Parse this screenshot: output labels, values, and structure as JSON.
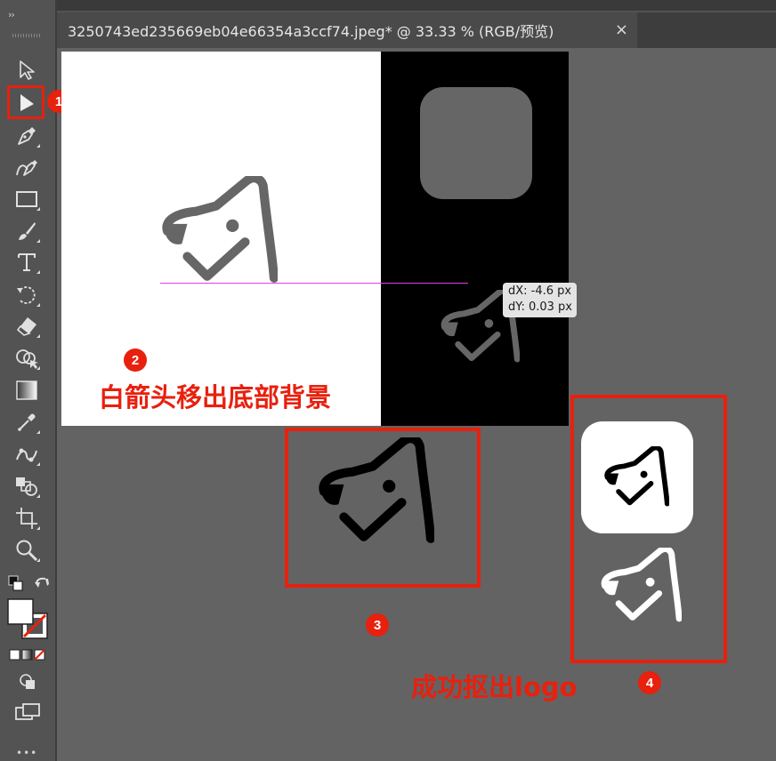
{
  "toolbar": {
    "collapse_glyph": "››",
    "tools": [
      {
        "name": "selection-tool",
        "icon": "arrow-outline-icon"
      },
      {
        "name": "direct-selection-tool",
        "icon": "arrow-filled-icon"
      },
      {
        "name": "pen-tool",
        "icon": "pen-icon"
      },
      {
        "name": "curvature-tool",
        "icon": "curvature-pen-icon"
      },
      {
        "name": "rectangle-tool",
        "icon": "rectangle-icon"
      },
      {
        "name": "paintbrush-tool",
        "icon": "brush-icon"
      },
      {
        "name": "type-tool",
        "icon": "type-icon",
        "glyph": "T"
      },
      {
        "name": "rotate-tool",
        "icon": "rotate-icon"
      },
      {
        "name": "eraser-tool",
        "icon": "eraser-icon"
      },
      {
        "name": "shape-builder-tool",
        "icon": "shape-builder-icon"
      },
      {
        "name": "gradient-tool",
        "icon": "gradient-icon"
      },
      {
        "name": "eyedropper-tool",
        "icon": "eyedropper-icon"
      },
      {
        "name": "puppet-warp-tool",
        "icon": "puppet-warp-icon"
      },
      {
        "name": "blend-tool",
        "icon": "blend-icon"
      },
      {
        "name": "artboard-tool",
        "icon": "artboard-icon"
      },
      {
        "name": "zoom-tool",
        "icon": "zoom-icon"
      }
    ],
    "more_glyph": "•••"
  },
  "document": {
    "tab_title": "3250743ed235669eb04e66354a3ccf74.jpeg* @ 33.33 % (RGB/预览)",
    "close_glyph": "×"
  },
  "canvas": {
    "tooltip_dx": "dX: -4.6 px",
    "tooltip_dy": "dY: 0.03 px"
  },
  "annotations": {
    "badge_1": "1",
    "badge_2": "2",
    "badge_3": "3",
    "badge_4": "4",
    "step_2_text": "白箭头移出底部背景",
    "step_4_text": "成功抠出logo"
  },
  "colors": {
    "accent_red": "#e8200e",
    "logo_gray": "#666666",
    "workspace_gray": "#636363",
    "guide_magenta": "#e040e0"
  }
}
